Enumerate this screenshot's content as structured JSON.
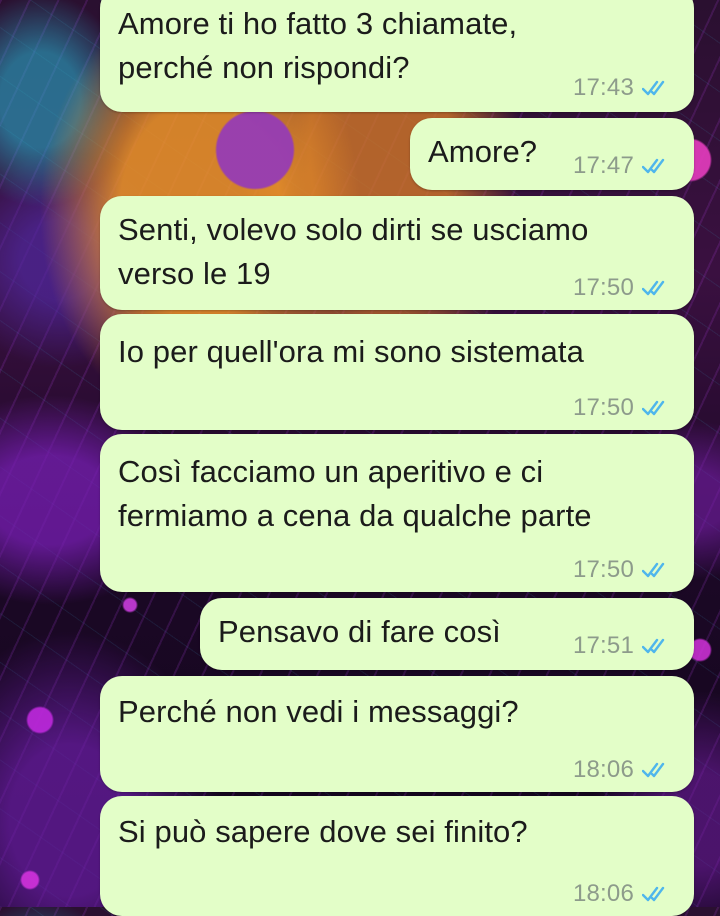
{
  "messages": [
    {
      "text": "Amore ti ho fatto 3 chiamate,\nperché non rispondi?",
      "time": "17:43",
      "status_icon": "double-check-read"
    },
    {
      "text": "Amore?",
      "time": "17:47",
      "status_icon": "double-check-read"
    },
    {
      "text": "Senti, volevo solo dirti se usciamo\nverso le 19",
      "time": "17:50",
      "status_icon": "double-check-read"
    },
    {
      "text": "Io per quell'ora mi sono sistemata",
      "time": "17:50",
      "status_icon": "double-check-read"
    },
    {
      "text": "Così facciamo un aperitivo e ci\nfermiamo a cena da qualche parte",
      "time": "17:50",
      "status_icon": "double-check-read"
    },
    {
      "text": "Pensavo di fare così",
      "time": "17:51",
      "status_icon": "double-check-read"
    },
    {
      "text": "Perché non vedi i messaggi?",
      "time": "18:06",
      "status_icon": "double-check-read"
    },
    {
      "text": "Si può sapere dove sei finito?",
      "time": "18:06",
      "status_icon": "double-check-read"
    }
  ],
  "colors": {
    "bubble_background": "#e3fec8",
    "message_text": "#1b1b1b",
    "timestamp": "#8d9b8b",
    "read_ticks": "#4fb6ec"
  }
}
